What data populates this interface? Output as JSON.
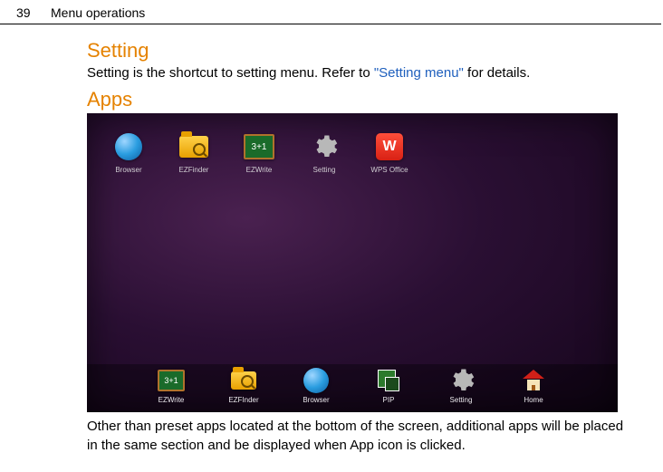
{
  "page": {
    "number": "39",
    "section": "Menu operations"
  },
  "heading_setting": "Setting",
  "text_setting_before": "Setting is the shortcut to setting menu. Refer to ",
  "text_setting_link": "\"Setting menu\"",
  "text_setting_after": " for details.",
  "heading_apps": "Apps",
  "text_apps_below": "Other than preset apps located at the bottom of the screen, additional apps will be placed in the same section and be displayed when App icon is clicked.",
  "top_apps": [
    {
      "label": "Browser"
    },
    {
      "label": "EZFinder"
    },
    {
      "label": "EZWrite"
    },
    {
      "label": "Setting"
    },
    {
      "label": "WPS Office"
    }
  ],
  "dock_apps": [
    {
      "label": "EZWrite"
    },
    {
      "label": "EZFInder"
    },
    {
      "label": "Browser"
    },
    {
      "label": "PIP"
    },
    {
      "label": "Setting"
    },
    {
      "label": "Home"
    }
  ],
  "board_text": "3+1"
}
